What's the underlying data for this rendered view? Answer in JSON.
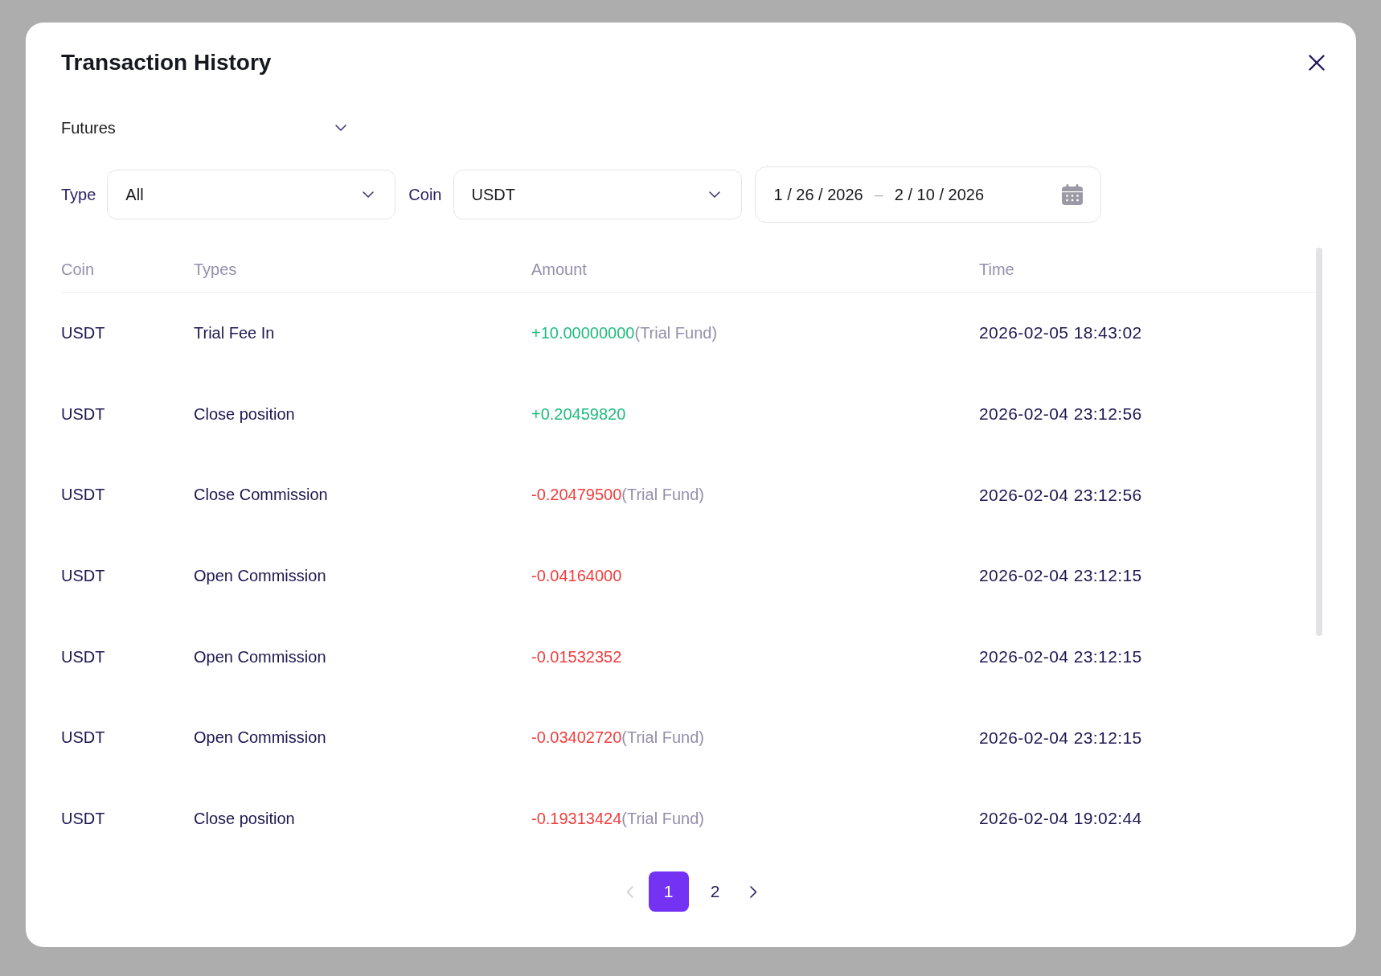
{
  "dialog": {
    "title": "Transaction History"
  },
  "account_select": {
    "value": "Futures"
  },
  "filters": [
    {
      "label": "Type",
      "value": "All"
    },
    {
      "label": "Coin",
      "value": "USDT"
    }
  ],
  "date_range": {
    "start": "1 / 26 / 2026",
    "separator": "–",
    "end": "2 / 10 / 2026"
  },
  "table": {
    "columns": [
      "Coin",
      "Types",
      "Amount",
      "Time"
    ],
    "rows": [
      {
        "coin": "USDT",
        "type": "Trial Fee In",
        "amount": "+10.00000000",
        "color": "#20bc7e",
        "note": "(Trial Fund)",
        "time": "2026-02-05 18:43:02"
      },
      {
        "coin": "USDT",
        "type": "Close position",
        "amount": "+0.20459820",
        "color": "#20bc7e",
        "time": "2026-02-04 23:12:56"
      },
      {
        "coin": "USDT",
        "type": "Close Commission",
        "amount": "-0.20479500",
        "color": "#f03d3d",
        "note": "(Trial Fund)",
        "time": "2026-02-04 23:12:56"
      },
      {
        "coin": "USDT",
        "type": "Open Commission",
        "amount": "-0.04164000",
        "color": "#f03d3d",
        "time": "2026-02-04 23:12:15"
      },
      {
        "coin": "USDT",
        "type": "Open Commission",
        "amount": "-0.01532352",
        "color": "#f03d3d",
        "time": "2026-02-04 23:12:15"
      },
      {
        "coin": "USDT",
        "type": "Open Commission",
        "amount": "-0.03402720",
        "color": "#f03d3d",
        "note": "(Trial Fund)",
        "time": "2026-02-04 23:12:15"
      },
      {
        "coin": "USDT",
        "type": "Close position",
        "amount": "-0.19313424",
        "color": "#f03d3d",
        "note": "(Trial Fund)",
        "time": "2026-02-04 19:02:44"
      }
    ]
  },
  "pagination": {
    "prev": {
      "disabled": true
    },
    "pages": [
      {
        "label": "1",
        "selected": true
      },
      {
        "label": "2",
        "selected": false
      }
    ],
    "next": {
      "disabled": false
    }
  }
}
